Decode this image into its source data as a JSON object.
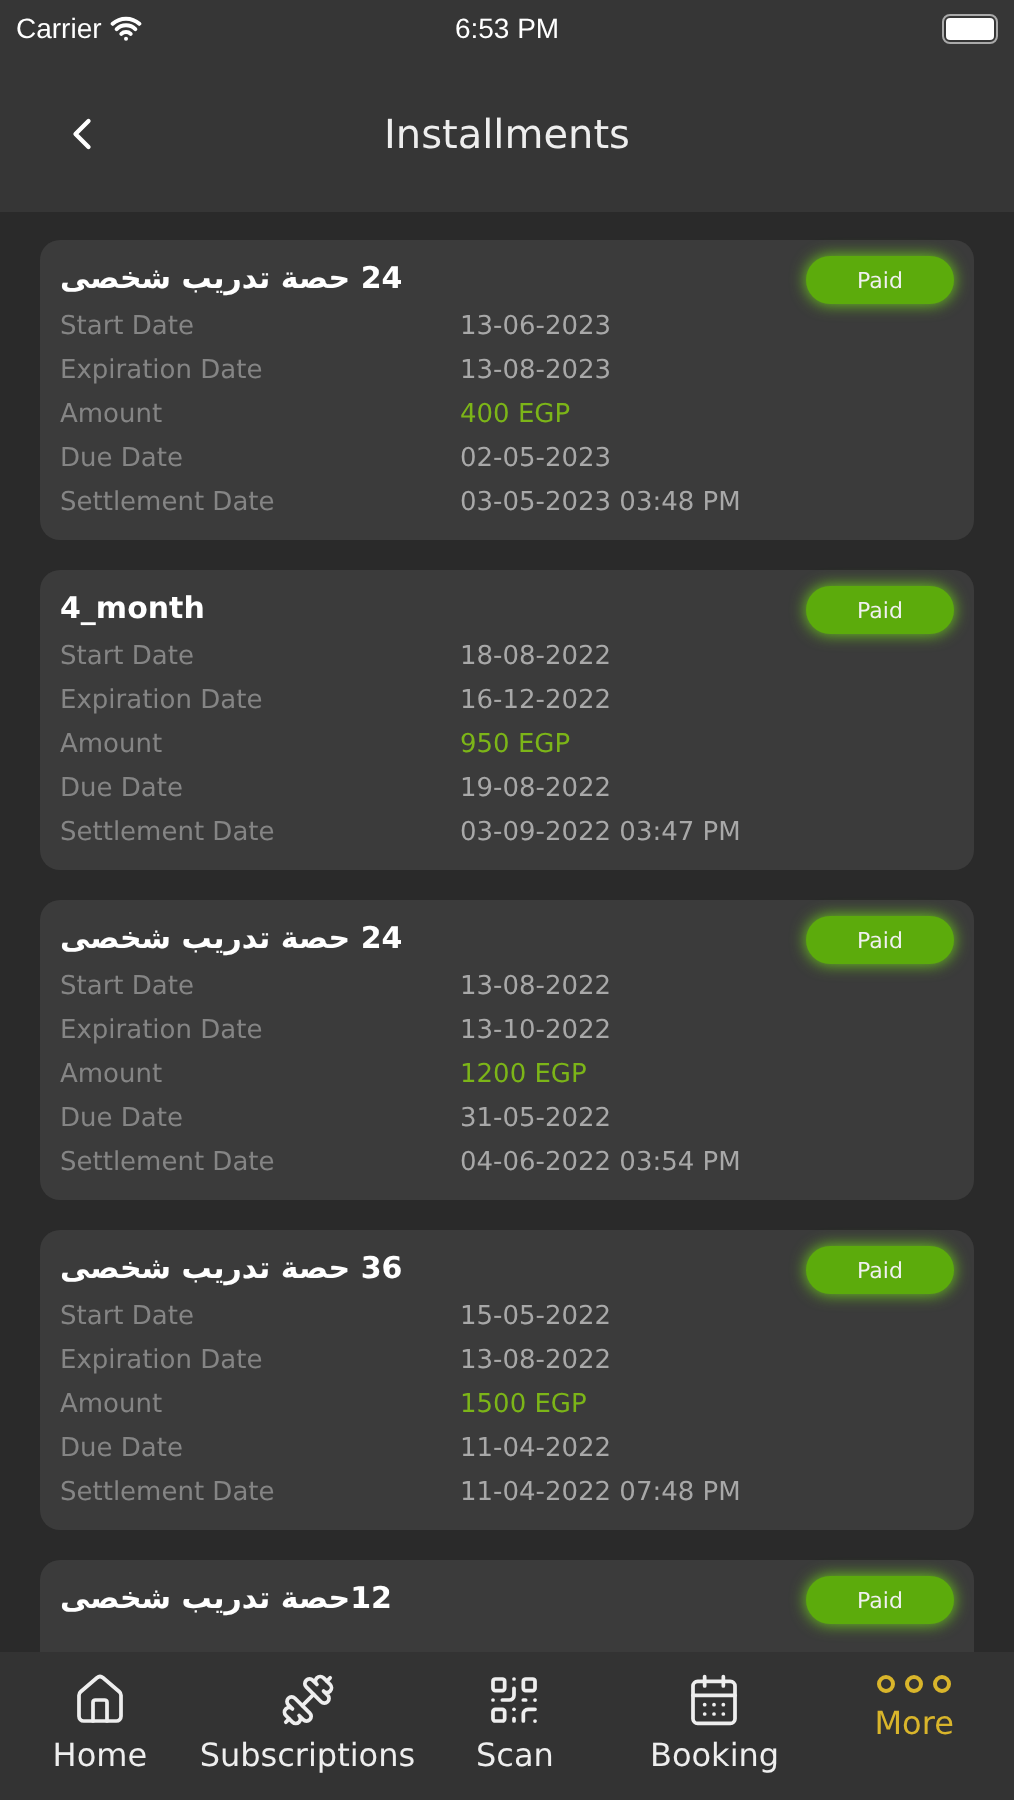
{
  "status_bar": {
    "carrier": "Carrier",
    "time": "6:53 PM"
  },
  "header": {
    "title": "Installments"
  },
  "installments": [
    {
      "title": "24 حصة تدريب شخصى",
      "status": "Paid",
      "fields": [
        {
          "label": "Start Date",
          "value": "13-06-2023",
          "kind": "date"
        },
        {
          "label": "Expiration Date",
          "value": "13-08-2023",
          "kind": "date"
        },
        {
          "label": "Amount",
          "value": "400 EGP",
          "kind": "amount"
        },
        {
          "label": "Due Date",
          "value": "02-05-2023",
          "kind": "date"
        },
        {
          "label": "Settlement Date",
          "value": "03-05-2023 03:48 PM",
          "kind": "date"
        }
      ]
    },
    {
      "title": "4_month",
      "status": "Paid",
      "fields": [
        {
          "label": "Start Date",
          "value": "18-08-2022",
          "kind": "date"
        },
        {
          "label": "Expiration Date",
          "value": "16-12-2022",
          "kind": "date"
        },
        {
          "label": "Amount",
          "value": "950 EGP",
          "kind": "amount"
        },
        {
          "label": "Due Date",
          "value": "19-08-2022",
          "kind": "date"
        },
        {
          "label": "Settlement Date",
          "value": "03-09-2022 03:47 PM",
          "kind": "date"
        }
      ]
    },
    {
      "title": "24 حصة تدريب شخصى",
      "status": "Paid",
      "fields": [
        {
          "label": "Start Date",
          "value": "13-08-2022",
          "kind": "date"
        },
        {
          "label": "Expiration Date",
          "value": "13-10-2022",
          "kind": "date"
        },
        {
          "label": "Amount",
          "value": "1200 EGP",
          "kind": "amount"
        },
        {
          "label": "Due Date",
          "value": "31-05-2022",
          "kind": "date"
        },
        {
          "label": "Settlement Date",
          "value": "04-06-2022 03:54 PM",
          "kind": "date"
        }
      ]
    },
    {
      "title": "36 حصة تدريب شخصى",
      "status": "Paid",
      "fields": [
        {
          "label": "Start Date",
          "value": "15-05-2022",
          "kind": "date"
        },
        {
          "label": "Expiration Date",
          "value": "13-08-2022",
          "kind": "date"
        },
        {
          "label": "Amount",
          "value": "1500 EGP",
          "kind": "amount"
        },
        {
          "label": "Due Date",
          "value": "11-04-2022",
          "kind": "date"
        },
        {
          "label": "Settlement Date",
          "value": "11-04-2022 07:48 PM",
          "kind": "date"
        }
      ]
    },
    {
      "title": "12حصة تدريب شخصى",
      "status": "Paid"
    }
  ],
  "tab_bar": [
    {
      "label": "Home",
      "selected": false
    },
    {
      "label": "Subscriptions",
      "selected": false
    },
    {
      "label": "Scan",
      "selected": false
    },
    {
      "label": "Booking",
      "selected": false
    },
    {
      "label": "More",
      "selected": true
    }
  ]
}
